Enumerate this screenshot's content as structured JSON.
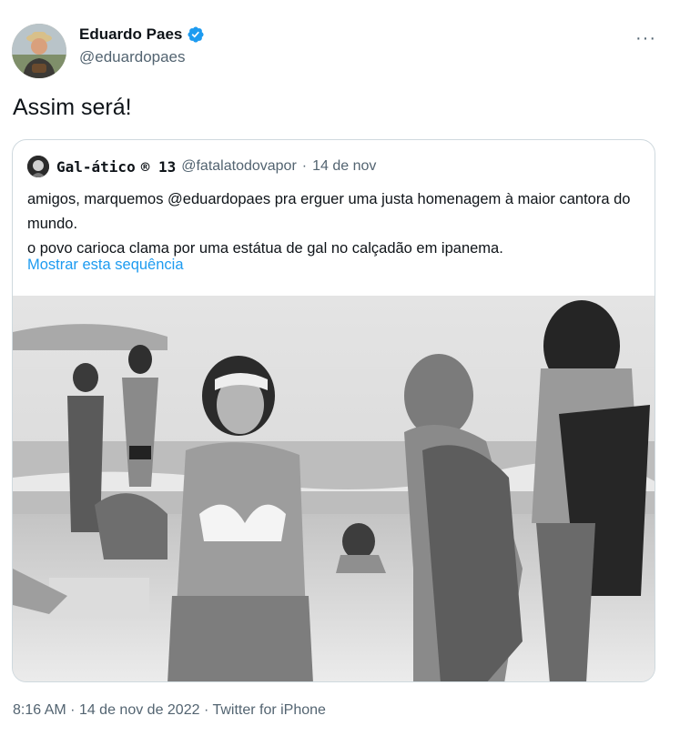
{
  "author": {
    "name": "Eduardo Paes",
    "handle": "@eduardopaes",
    "verified_color": "#1d9bf0"
  },
  "tweet": {
    "text": "Assim será!",
    "more_label": "···"
  },
  "quoted": {
    "name": "Gal-ático",
    "badge": "® 13",
    "handle": "@fatalatodovapor",
    "separator": "·",
    "date": "14 de nov",
    "lines": [
      "amigos, marquemos @eduardopaes pra erguer uma justa homenagem à maior cantora do mundo.",
      "o povo carioca clama por uma estátua de gal no calçadão em ipanema."
    ],
    "show_thread": "Mostrar esta sequência",
    "image_icon": "black-and-white-beach-photo"
  },
  "meta": {
    "time": "8:16 AM",
    "date": "14 de nov de 2022",
    "source": "Twitter for iPhone",
    "separator": "·"
  },
  "colors": {
    "link": "#1d9bf0",
    "secondary_text": "#536471",
    "border": "#cfd9de"
  }
}
